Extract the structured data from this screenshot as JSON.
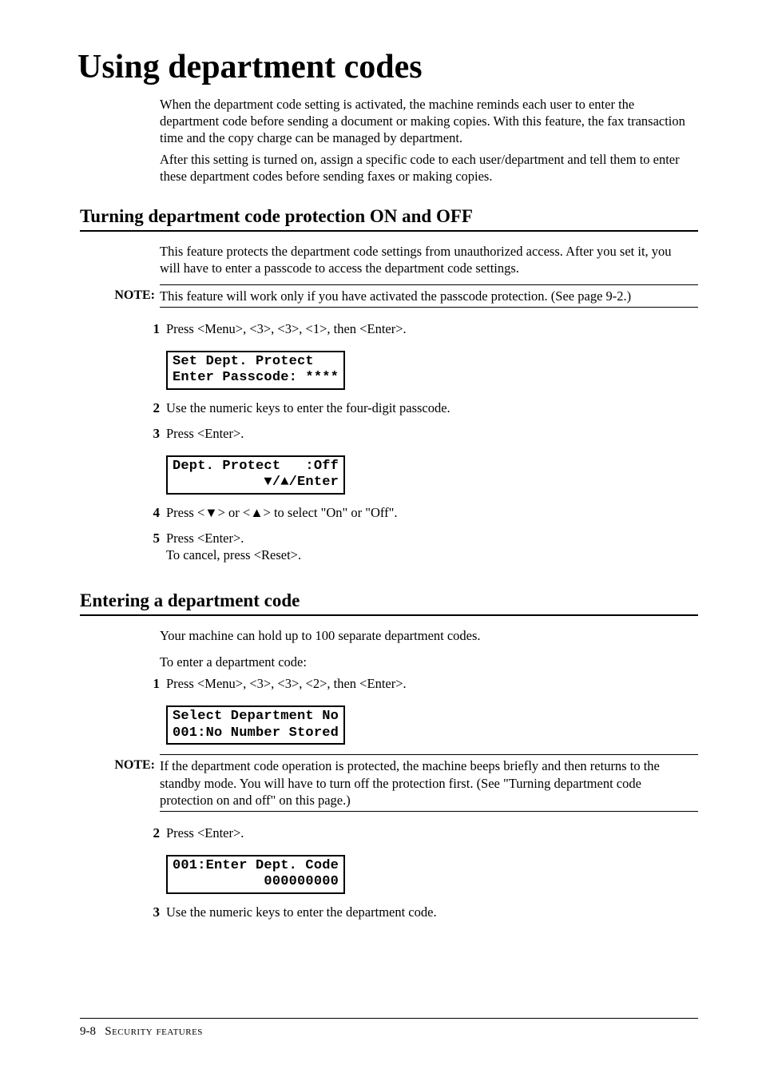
{
  "title": "Using department codes",
  "intro_p1": "When the department code setting is activated, the machine reminds each user to enter the department code before sending a document or making copies.  With this feature, the fax transaction time and the copy charge can be managed by department.",
  "intro_p2": "After this setting is turned on, assign a specific code to each user/department and tell them to enter these department codes before sending faxes or making copies.",
  "section1": {
    "heading": "Turning department code protection ON and OFF",
    "para": "This feature protects the department code settings from unauthorized access. After you set it, you will have to enter a passcode to access the department code settings.",
    "note_label": "NOTE:",
    "note_text": "This feature will work only if you have activated the passcode protection.  (See page 9-2.)",
    "steps": [
      {
        "num": "1",
        "text": "Press <Menu>, <3>, <3>, <1>, then <Enter>.",
        "lcd1": "Set Dept. Protect",
        "lcd2": "Enter Passcode: ****"
      },
      {
        "num": "2",
        "text": "Use the numeric keys to enter the four-digit passcode."
      },
      {
        "num": "3",
        "text": "Press <Enter>.",
        "lcd1": "Dept. Protect   :Off",
        "lcd2": "           ▼/▲/Enter"
      },
      {
        "num": "4",
        "text": "Press <▼> or <▲> to select \"On\" or \"Off\"."
      },
      {
        "num": "5",
        "text": "Press <Enter>.",
        "text2": "To cancel, press <Reset>."
      }
    ]
  },
  "section2": {
    "heading": "Entering a department code",
    "para1": "Your machine can hold up to 100 separate department codes.",
    "para2": "To enter a department code:",
    "steps_a": [
      {
        "num": "1",
        "text": "Press <Menu>, <3>, <3>, <2>, then <Enter>.",
        "lcd1": "Select Department No",
        "lcd2": "001:No Number Stored"
      }
    ],
    "note_label": "NOTE:",
    "note_text": "If the department code operation is protected, the machine beeps briefly and then returns to the standby mode.  You will have to turn off the protection first. (See \"Turning department code protection on and off\" on this page.)",
    "steps_b": [
      {
        "num": "2",
        "text": "Press <Enter>.",
        "lcd1": "001:Enter Dept. Code",
        "lcd2": "           000000000"
      },
      {
        "num": "3",
        "text": "Use the numeric keys to enter the department code."
      }
    ]
  },
  "footer": {
    "page": "9-8",
    "label": "Security features"
  }
}
